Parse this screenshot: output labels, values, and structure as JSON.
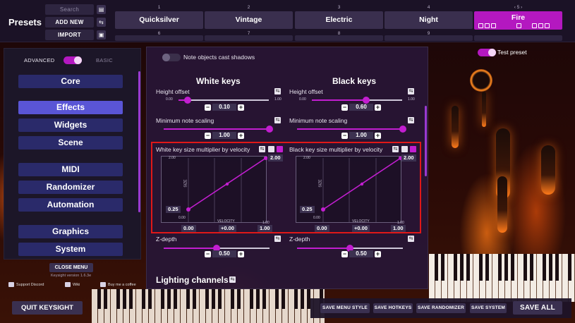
{
  "topbar": {
    "title": "Presets",
    "search_placeholder": "Search",
    "add_new": "ADD NEW",
    "import": "IMPORT",
    "presets": [
      {
        "num": "1",
        "name": "Quicksilver"
      },
      {
        "num": "2",
        "name": "Vintage"
      },
      {
        "num": "3",
        "name": "Electric"
      },
      {
        "num": "4",
        "name": "Night"
      },
      {
        "num": "5",
        "name": "Fire"
      }
    ],
    "lower_nums": [
      "6",
      "7",
      "8",
      "9"
    ],
    "active_nav": "5"
  },
  "sidebar": {
    "advanced": "ADVANCED",
    "basic": "BASIC",
    "items": [
      "Core",
      "Effects",
      "Widgets",
      "Scene",
      "MIDI",
      "Randomizer",
      "Automation",
      "Graphics",
      "System"
    ],
    "active": "Effects",
    "close_menu": "CLOSE MENU",
    "version": "Keysight version 1.6.3e",
    "links": [
      "Support Discord",
      "Wiki",
      "Buy me a coffee"
    ],
    "quit": "QUIT KEYSIGHT"
  },
  "panel": {
    "shadows_label": "Note objects cast shadows",
    "white_title": "White keys",
    "black_title": "Black keys",
    "height_offset": "Height offset",
    "min_note_scaling": "Minimum note scaling",
    "white_height_value": "0.10",
    "black_height_value": "0.60",
    "white_min_value": "1.00",
    "black_min_value": "1.00",
    "range_min": "0.00",
    "range_max": "1.00",
    "white_height_fraction": 0.1,
    "black_height_fraction": 0.6,
    "white_min_fraction": 1.0,
    "black_min_fraction": 1.0,
    "white_vel_label": "White key size multiplier by velocity",
    "black_vel_label": "Black key size multiplier by velocity",
    "curve": {
      "y_top": "2.00",
      "y_bottom": "0.25",
      "x_left": "0.00",
      "x_mid": "+0.00",
      "x_right": "1.00",
      "axis_y": "SIZE",
      "axis_x": "VELOCITY",
      "tick_top": "2.00",
      "tick_bottom": "0.00",
      "tick_x_left": "0.00",
      "tick_x_right": "1.00"
    },
    "z_depth": "Z-depth",
    "z_value_white": "0.50",
    "z_value_black": "0.50",
    "z_fraction": 0.5,
    "lighting": "Lighting channels"
  },
  "right": {
    "test_preset": "Test preset"
  },
  "bottombar": {
    "save_menu_style": "SAVE MENU STYLE",
    "save_hotkeys": "SAVE HOTKEYS",
    "save_randomizer": "SAVE RANDOMIZER",
    "save_system": "SAVE SYSTEM",
    "save_all": "SAVE ALL"
  },
  "colors": {
    "accent": "#c21ed0",
    "nav_active": "#5a55d6",
    "nav": "#2a2a6a",
    "highlight_border": "#e01818"
  }
}
